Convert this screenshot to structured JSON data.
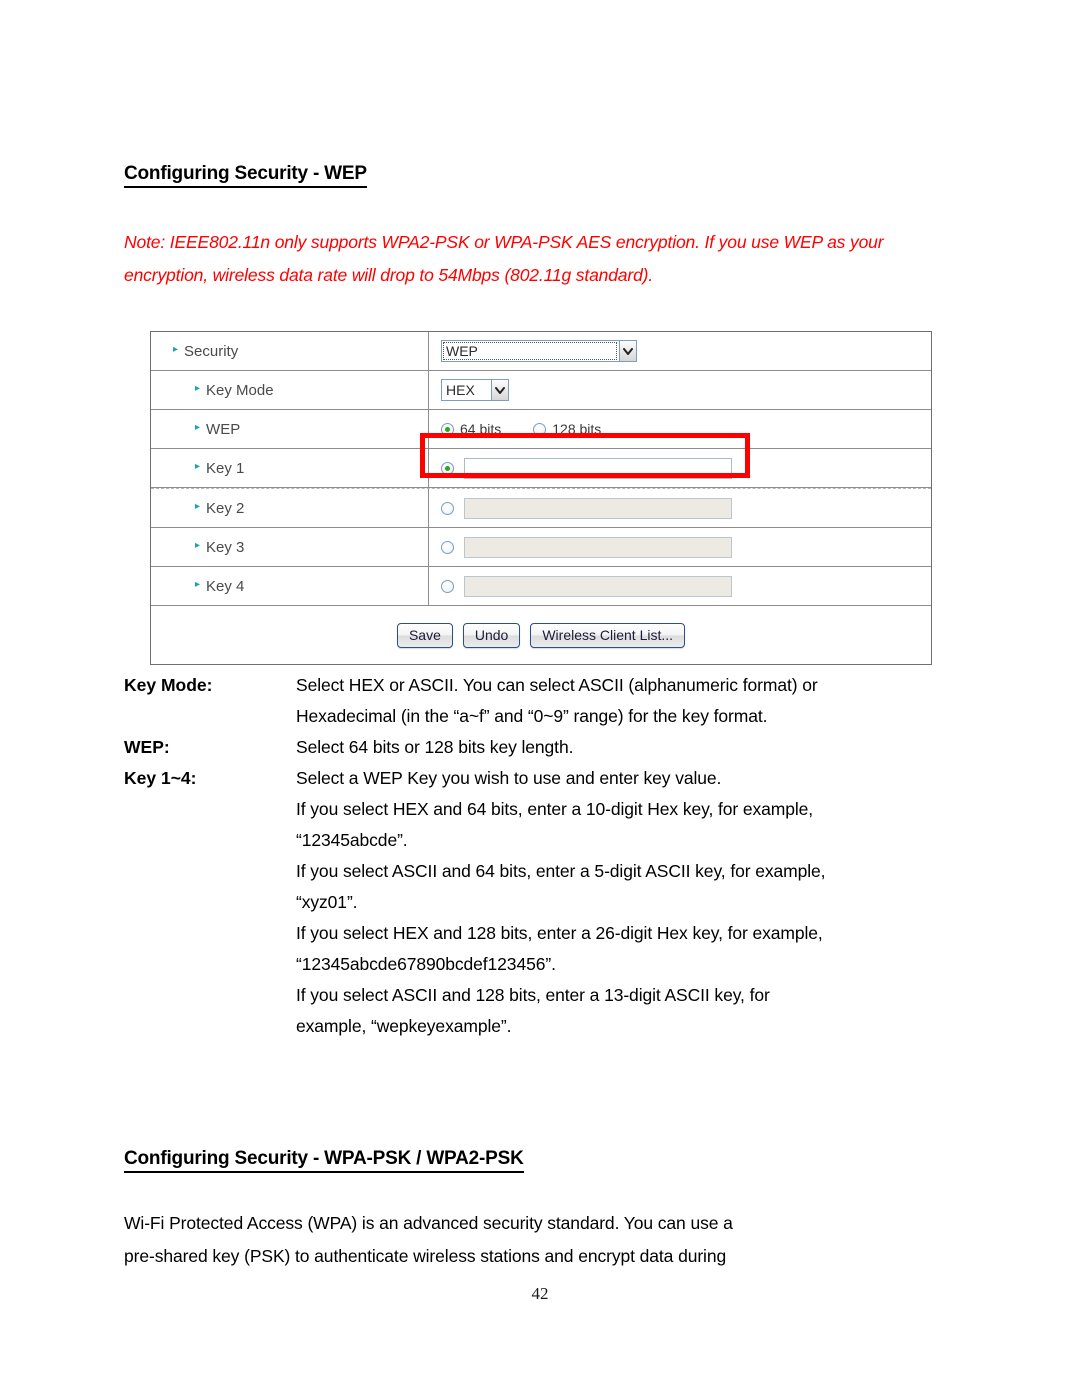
{
  "headings": {
    "wep": "Configuring Security - WEP",
    "wpa": "Configuring Security - WPA-PSK / WPA2-PSK"
  },
  "note": {
    "color": "#ff0000",
    "line1": "Note: IEEE802.11n only supports WPA2-PSK or WPA-PSK AES encryption. If you use WEP as",
    "line2": "your encryption, wireless data rate will drop to 54Mbps (802.11g standard)."
  },
  "panel": {
    "rows": [
      {
        "label": "Security",
        "control": "select",
        "value": "WEP"
      },
      {
        "label": "Key Mode",
        "control": "select",
        "value": "HEX"
      },
      {
        "label": "WEP",
        "control": "radios"
      },
      {
        "label": "Key 1",
        "control": "key",
        "value": "",
        "selected": true
      },
      {
        "label": "Key 2",
        "control": "key",
        "value": "",
        "selected": false
      },
      {
        "label": "Key 3",
        "control": "key",
        "value": "",
        "selected": false
      },
      {
        "label": "Key 4",
        "control": "key",
        "value": "",
        "selected": false
      }
    ],
    "wep_radio_options": [
      {
        "label": "64 bits",
        "selected": true
      },
      {
        "label": "128 bits",
        "selected": false
      }
    ],
    "buttons": [
      {
        "label": "Save"
      },
      {
        "label": "Undo"
      },
      {
        "label": "Wireless Client List..."
      }
    ],
    "highlight_color": "#ff0000",
    "bullet_color": "#1aa6a6"
  },
  "definitions": [
    {
      "term": "Key Mode",
      "colon": ":",
      "lines": [
        "Select HEX or ASCII. You can select ASCII (alphanumeric format) or",
        "Hexadecimal (in the “a~f” and “0~9” range) for the key format."
      ]
    },
    {
      "term": "WEP",
      "colon": ":",
      "lines": [
        "Select 64 bits or 128 bits key length."
      ]
    },
    {
      "term": "Key 1~4",
      "colon": ":",
      "lines": [
        "Select a WEP Key you wish to use and enter key value.",
        "If you select HEX and 64 bits, enter a 10-digit Hex key, for example,",
        "“12345abcde”.",
        "If you select ASCII and 64 bits, enter a 5-digit ASCII key, for example,",
        "“xyz01”.",
        "If you select HEX and 128 bits, enter a 26-digit Hex key, for example,",
        "“12345abcde67890bcdef123456”.",
        "If you select ASCII and 128 bits, enter a 13-digit ASCII key, for",
        "example, “wepkeyexample”."
      ]
    }
  ],
  "paragraph": {
    "line1": "Wi-Fi Protected Access (WPA) is an advanced security standard. You can use a",
    "line2": "pre-shared key (PSK) to authenticate wireless stations and encrypt data during"
  },
  "footer": {
    "page_number": "42"
  }
}
